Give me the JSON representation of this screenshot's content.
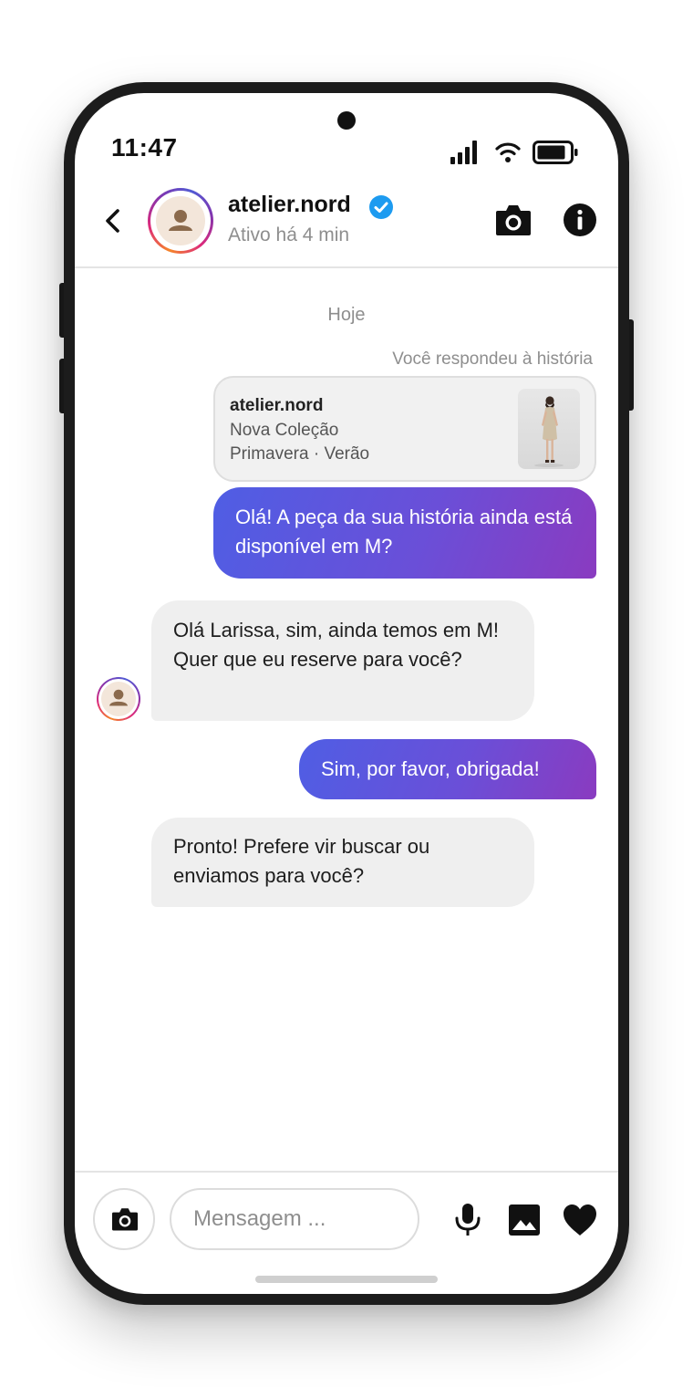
{
  "status_bar": {
    "time": "11:47"
  },
  "header": {
    "username": "atelier.nord",
    "active_status": "Ativo há 4 min",
    "verified": true
  },
  "conversation": {
    "date_separator": "Hoje",
    "story_reply": {
      "note": "Você respondeu à história",
      "account": "atelier.nord",
      "line1": "Nova Coleção",
      "line2": "Primavera · Verão"
    },
    "messages": [
      {
        "from": "me",
        "text": "Olá! A peça da sua história ainda está disponível em M?"
      },
      {
        "from": "them",
        "text": "Olá Larissa, sim, ainda temos em M! Quer que eu reserve para você?"
      },
      {
        "from": "me",
        "text": "Sim, por favor, obrigada!"
      },
      {
        "from": "them",
        "text": "Pronto! Prefere vir buscar ou enviamos para você?"
      }
    ]
  },
  "composer": {
    "placeholder": "Mensagem ..."
  },
  "colors": {
    "outgoing_gradient_start": "#4f5ee4",
    "outgoing_gradient_end": "#8a3bc0",
    "incoming_bubble": "#efefef",
    "verified_badge": "#1d9bf0",
    "secondary_text": "#8e8e8e"
  },
  "icons": [
    "back-arrow-icon",
    "verified-badge-icon",
    "camera-icon",
    "info-icon",
    "signal-icon",
    "wifi-icon",
    "battery-icon",
    "microphone-icon",
    "image-icon",
    "heart-icon"
  ]
}
